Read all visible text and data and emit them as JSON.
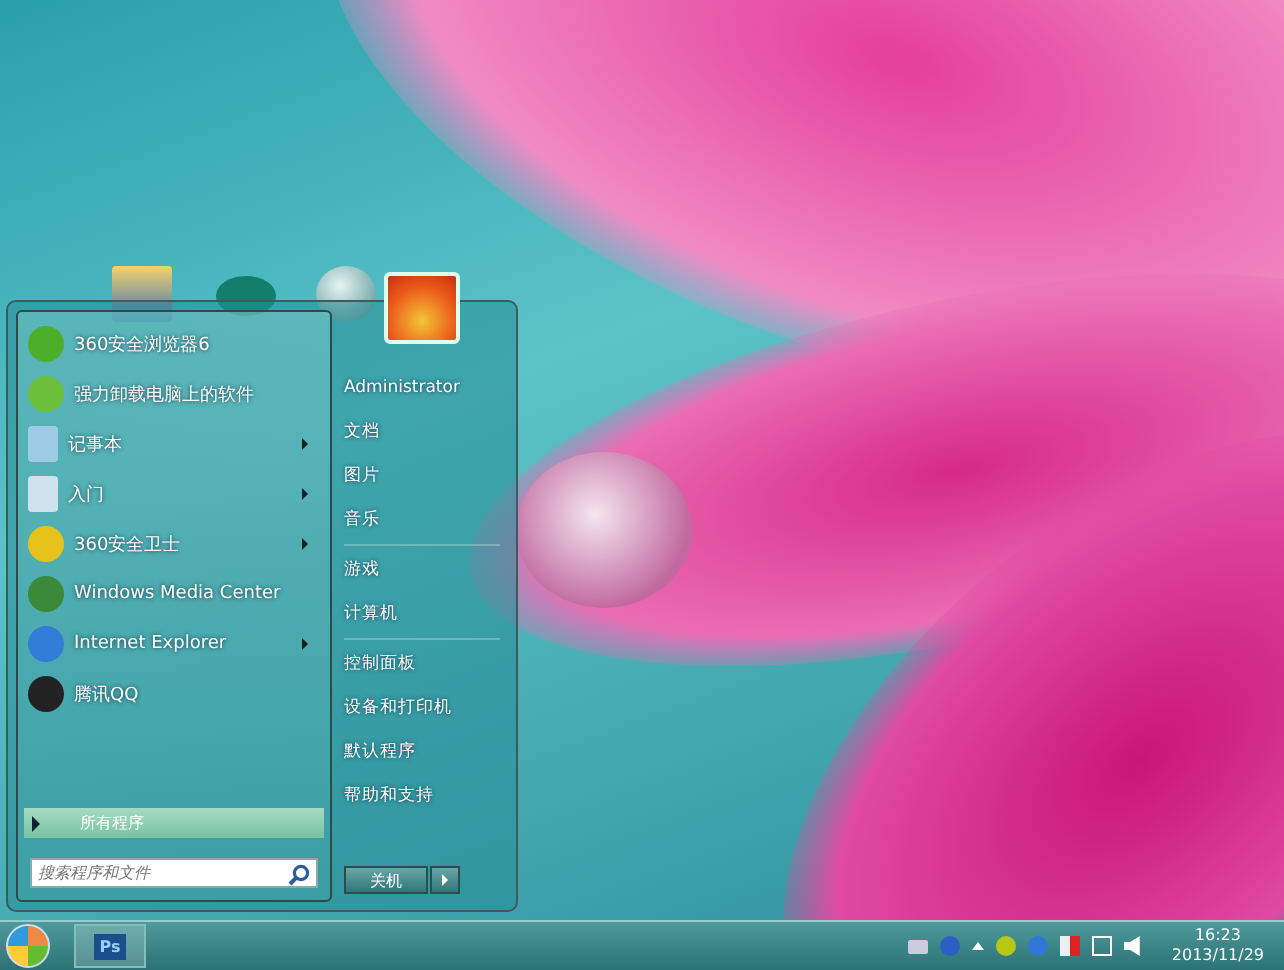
{
  "start_menu": {
    "programs": [
      {
        "label": "360安全浏览器6",
        "submenu": false
      },
      {
        "label": "强力卸载电脑上的软件",
        "submenu": false
      },
      {
        "label": "记事本",
        "submenu": true
      },
      {
        "label": "入门",
        "submenu": true
      },
      {
        "label": "360安全卫士",
        "submenu": true
      },
      {
        "label": "Windows Media Center",
        "submenu": false
      },
      {
        "label": "Internet Explorer",
        "submenu": true
      },
      {
        "label": "腾讯QQ",
        "submenu": false
      }
    ],
    "all_programs": "所有程序",
    "search": {
      "placeholder": "搜索程序和文件"
    },
    "place_groups": [
      [
        "Administrator",
        "文档",
        "图片",
        "音乐"
      ],
      [
        "游戏",
        "计算机"
      ],
      [
        "控制面板",
        "设备和打印机",
        "默认程序",
        "帮助和支持"
      ]
    ],
    "shutdown": "关机"
  },
  "taskbar": {
    "pinned": [
      {
        "label": "Ps"
      }
    ],
    "clock": {
      "time": "16:23",
      "date": "2013/11/29"
    }
  }
}
